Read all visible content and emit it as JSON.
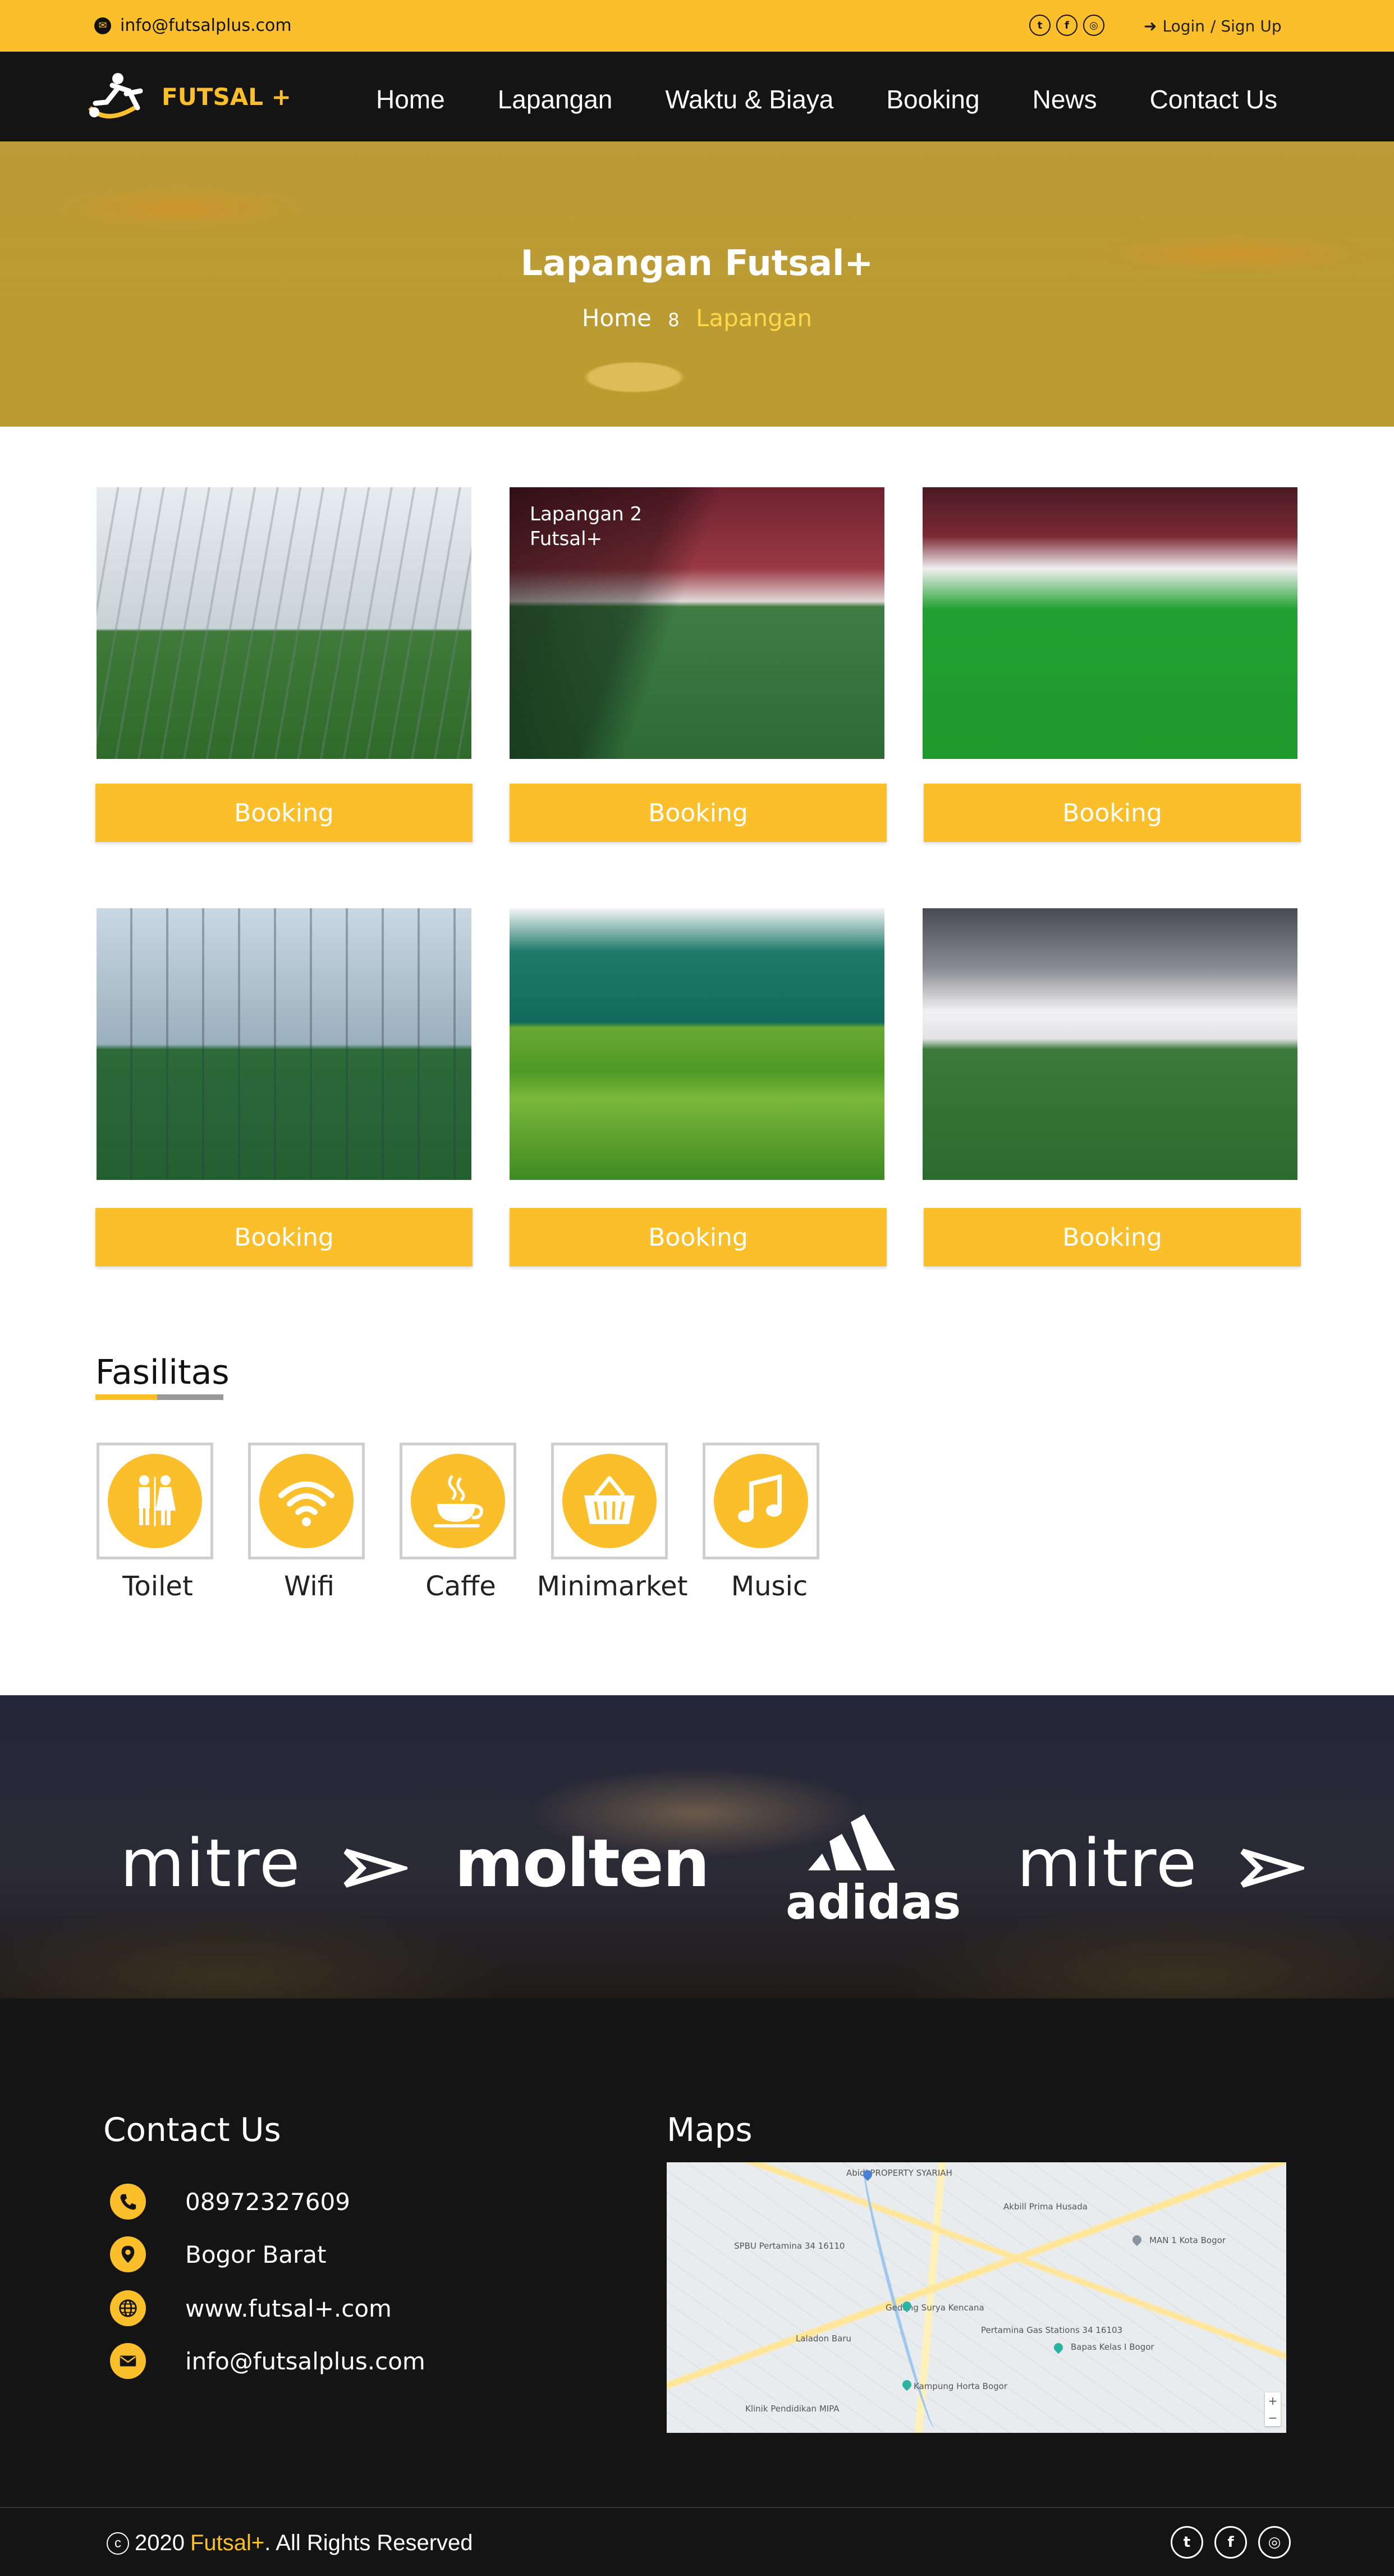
{
  "topbar": {
    "email": "info@futsalplus.com",
    "socials": [
      "twitter-icon",
      "facebook-icon",
      "instagram-icon"
    ],
    "login": "Login",
    "signup": "/ Sign Up"
  },
  "nav": {
    "brand": "FUTSAL +",
    "items": [
      "Home",
      "Lapangan",
      "Waktu & Biaya",
      "Booking",
      "News",
      "Contact Us"
    ]
  },
  "hero": {
    "title": "Lapangan Futsal+",
    "breadcrumb_home": "Home",
    "breadcrumb_current": "Lapangan"
  },
  "fields": [
    {
      "caption": "",
      "button": "Booking"
    },
    {
      "caption": "Lapangan 2\nFutsal+",
      "button": "Booking"
    },
    {
      "caption": "",
      "button": "Booking"
    },
    {
      "caption": "",
      "button": "Booking"
    },
    {
      "caption": "",
      "button": "Booking"
    },
    {
      "caption": "",
      "button": "Booking"
    }
  ],
  "facilities": {
    "title": "Fasilitas",
    "items": [
      {
        "label": "Toilet",
        "icon": "toilet-icon"
      },
      {
        "label": "Wifi",
        "icon": "wifi-icon"
      },
      {
        "label": "Caffe",
        "icon": "coffee-icon"
      },
      {
        "label": "Minimarket",
        "icon": "basket-icon"
      },
      {
        "label": "Music",
        "icon": "music-icon"
      }
    ]
  },
  "sponsors": [
    "mitre",
    "molten",
    "adidas",
    "mitre"
  ],
  "footer": {
    "contact_title": "Contact Us",
    "maps_title": "Maps",
    "contacts": [
      {
        "icon": "phone-icon",
        "text": "08972327609"
      },
      {
        "icon": "location-icon",
        "text": "Bogor Barat"
      },
      {
        "icon": "globe-icon",
        "text": "www.futsal+.com"
      },
      {
        "icon": "mail-icon",
        "text": "info@futsalplus.com"
      }
    ],
    "map_labels": [
      "Abidi PROPERTY SYARIAH",
      "SPBU Pertamina 34 16110",
      "Gedung Surya Kencana",
      "Pertamina Gas Stations 34 16103",
      "Bapas Kelas I Bogor",
      "Kampung Horta Bogor",
      "Klinik Pendidikan MIPA",
      "Laladon Baru",
      "MAN 1 Kota Bogor",
      "Akbill Prima Husada"
    ],
    "copyright_pre": "2020",
    "copyright_brand": "Futsal+",
    "copyright_post": ". All Rights Reserved",
    "copyright_symbol": "c"
  },
  "colors": {
    "accent": "#fbbf2c",
    "dark": "#141414"
  }
}
